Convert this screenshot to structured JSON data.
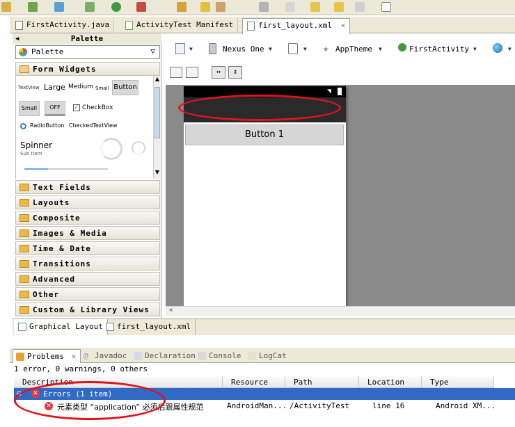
{
  "editor_tabs": [
    {
      "label": "FirstActivity.java",
      "icon": "java-file-icon"
    },
    {
      "label": "ActivityTest Manifest",
      "icon": "android-manifest-icon"
    },
    {
      "label": "first_layout.xml",
      "icon": "xml-file-icon",
      "active": true,
      "close": "✕"
    }
  ],
  "palette": {
    "header": "Palette",
    "select_value": "Palette",
    "form_widgets": {
      "label": "Form Widgets",
      "textview": "TextView",
      "large": "Large",
      "medium": "Medium",
      "small": "Small",
      "button": "Button",
      "small_button": "Small",
      "toggle": "OFF",
      "checkbox": "CheckBox",
      "radio": "RadioButton",
      "checked_text": "CheckedTextView",
      "spinner": "Spinner",
      "sub_item": "Sub Item"
    },
    "categories": [
      "Text Fields",
      "Layouts",
      "Composite",
      "Images & Media",
      "Time & Date",
      "Transitions",
      "Advanced",
      "Other",
      "Custom & Library Views"
    ]
  },
  "canvas_toolbar": {
    "device": "Nexus One",
    "theme": "AppTheme",
    "activity": "FirstActivity"
  },
  "device_preview": {
    "button_label": "Button 1"
  },
  "bottom_tabs": [
    {
      "label": "Graphical Layout",
      "active": true
    },
    {
      "label": "first_layout.xml"
    }
  ],
  "views_tabs": [
    {
      "label": "Problems",
      "active": true,
      "close": "✕"
    },
    {
      "label": "Javadoc"
    },
    {
      "label": "Declaration"
    },
    {
      "label": "Console"
    },
    {
      "label": "LogCat"
    }
  ],
  "problems": {
    "summary": "1 error, 0 warnings, 0 others",
    "columns": [
      "Description",
      "Resource",
      "Path",
      "Location",
      "Type"
    ],
    "group": {
      "toggle": "⊟",
      "label": "Errors (1 item)"
    },
    "rows": [
      {
        "description": "元素类型 “application” 必须后跟属性规范",
        "resource": "AndroidMan...",
        "path": "/ActivityTest",
        "location": "line 16",
        "type": "Android XM..."
      }
    ]
  },
  "colors": {
    "selection": "#316ac5",
    "annotation": "#e0141e",
    "error": "#e03b3b"
  }
}
